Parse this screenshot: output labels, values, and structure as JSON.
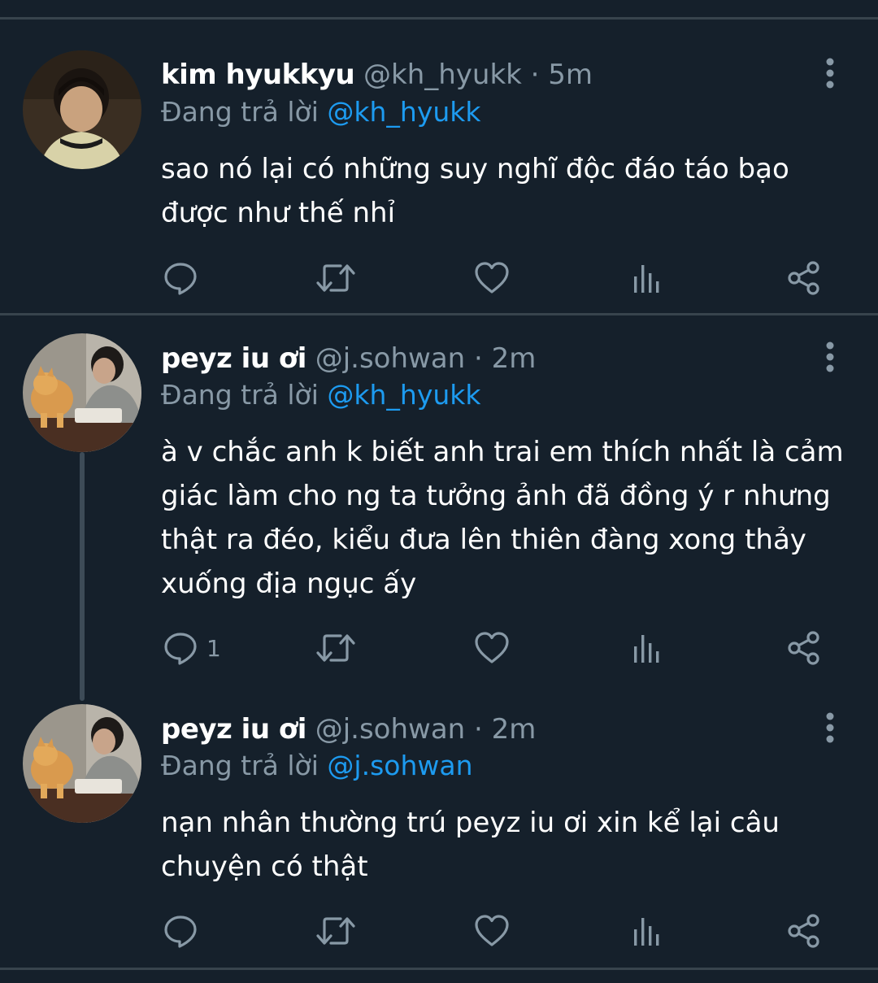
{
  "colors": {
    "background": "#15202b",
    "divider": "#38444d",
    "secondary_text": "#8899a6",
    "mention": "#1d9bf0",
    "icon": "#8899a6"
  },
  "tweets": [
    {
      "display_name": "kim hyukkyu",
      "handle": "@kh_hyukk",
      "separator": "·",
      "time": "5m",
      "reply_prefix": "Đang trả lời",
      "reply_mention": "@kh_hyukk",
      "text": "sao nó lại có những suy nghĩ độc đáo táo bạo được như thế nhỉ",
      "reply_count": ""
    },
    {
      "display_name": "peyz iu ơi",
      "handle": "@j.sohwan",
      "separator": "·",
      "time": "2m",
      "reply_prefix": "Đang trả lời",
      "reply_mention": "@kh_hyukk",
      "text": "à v chắc anh k biết anh trai em thích nhất là cảm giác làm cho ng ta tưởng ảnh đã đồng ý r nhưng thật ra đéo, kiểu đưa lên thiên đàng xong thảy xuống địa ngục ấy",
      "reply_count": "1"
    },
    {
      "display_name": "peyz iu ơi",
      "handle": "@j.sohwan",
      "separator": "·",
      "time": "2m",
      "reply_prefix": "Đang trả lời",
      "reply_mention": "@j.sohwan",
      "text": "nạn nhân thường trú peyz iu ơi xin kể lại câu chuyện có thật",
      "reply_count": ""
    }
  ],
  "icons": {
    "reply": "reply-icon",
    "retweet": "retweet-icon",
    "like": "heart-icon",
    "analytics": "analytics-icon",
    "share": "share-icon",
    "more": "more-vertical-icon"
  }
}
